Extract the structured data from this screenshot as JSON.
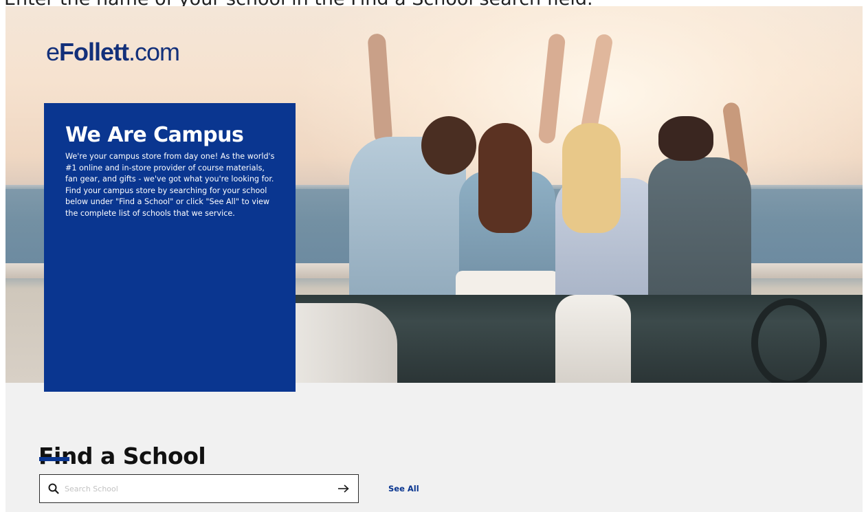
{
  "instruction": "Enter the name of your school in the Find a School search field.",
  "header": {
    "logo_prefix": "e",
    "logo_bold": "Follett",
    "logo_suffix": ".com"
  },
  "hero": {
    "title": "We Are Campus",
    "description": "We're your campus store from day one! As the world's #1 online and in-store provider of course materials, fan gear, and gifts - we've got what you're looking for. Find your campus store by searching for your school below under \"Find a School\" or click \"See All\" to view the complete list of schools that we service."
  },
  "find_school": {
    "title": "Find a School",
    "search_placeholder": "Search School",
    "search_value": "",
    "see_all_label": "See All"
  },
  "icons": {
    "search": "search-icon",
    "submit": "arrow-right-icon"
  },
  "colors": {
    "brand_blue": "#0a3690",
    "page_background": "#f1f1f1"
  }
}
